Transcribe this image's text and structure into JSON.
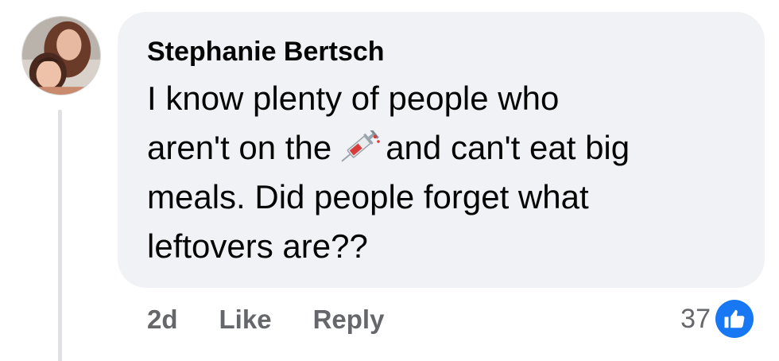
{
  "comment": {
    "author": "Stephanie Bertsch",
    "text_lines": [
      {
        "before": "I know plenty of people who",
        "after": ""
      },
      {
        "before": "aren't on the",
        "after": "and can't eat big"
      },
      {
        "before": "meals. Did people forget what",
        "after": ""
      },
      {
        "before": "leftovers are??",
        "after": ""
      }
    ],
    "inline_icon": "syringe-icon",
    "avatar_icon": "profile-photo"
  },
  "actions": {
    "time": "2d",
    "like_label": "Like",
    "reply_label": "Reply"
  },
  "reactions": {
    "count": "37",
    "icon": "thumbs-up-icon"
  },
  "colors": {
    "bubble": "#f0f2f5",
    "text": "#050505",
    "secondary_text": "#65676b",
    "like_blue": "#1877f2",
    "thread_line": "#dfe1e5"
  }
}
